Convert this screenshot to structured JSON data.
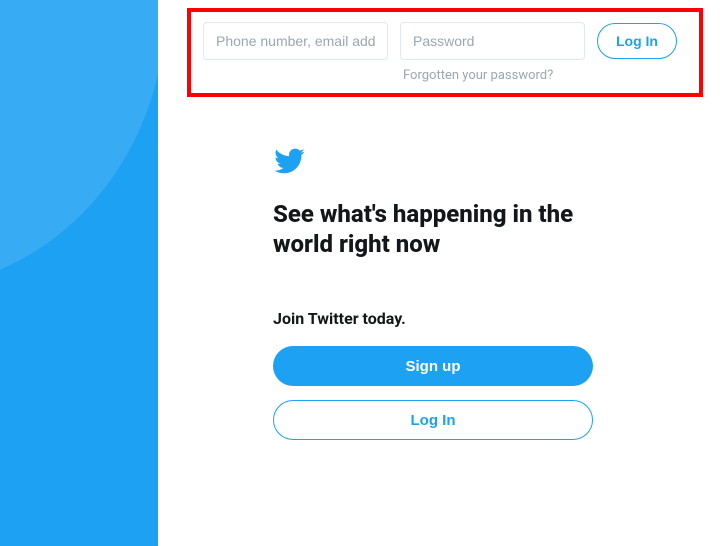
{
  "colors": {
    "brand": "#1da1f2",
    "highlight_border": "#ff0000"
  },
  "top_login": {
    "username_placeholder": "Phone number, email address",
    "password_placeholder": "Password",
    "login_button": "Log In",
    "forgot_link": "Forgotten your password?"
  },
  "content": {
    "headline": "See what's happening in the world right now",
    "join_text": "Join Twitter today.",
    "signup_button": "Sign up",
    "login_button": "Log In"
  }
}
